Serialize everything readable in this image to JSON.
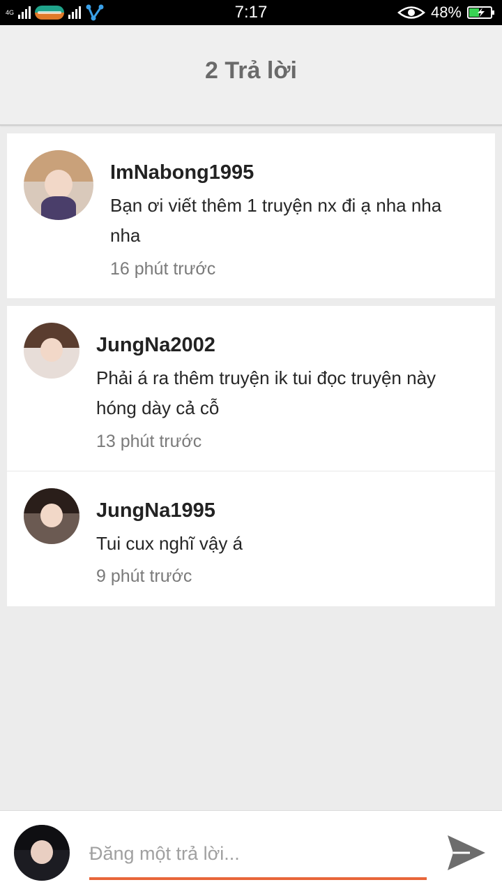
{
  "status_bar": {
    "network": "4G",
    "time": "7:17",
    "battery_percent": "48%",
    "battery_level": 0.48
  },
  "header": {
    "title": "2 Trả lời"
  },
  "comments": [
    {
      "username": "ImNabong1995",
      "text": "Bạn ơi viết thêm 1 truyện nx đi ạ nha nha nha",
      "time": "16 phút trước"
    },
    {
      "username": "JungNa2002",
      "text": "Phải á ra thêm truyện ik tui đọc truyện này hóng dày cả cỗ",
      "time": "13 phút trước"
    },
    {
      "username": "JungNa1995",
      "text": "Tui cux nghĩ vậy á",
      "time": "9 phút trước"
    }
  ],
  "reply_box": {
    "placeholder": "Đăng một trả lời...",
    "value": "",
    "send_icon": "send-icon"
  },
  "colors": {
    "accent": "#e8663a",
    "header_bg": "#efefef",
    "page_bg": "#ececec",
    "title_text": "#6a6a6a"
  }
}
